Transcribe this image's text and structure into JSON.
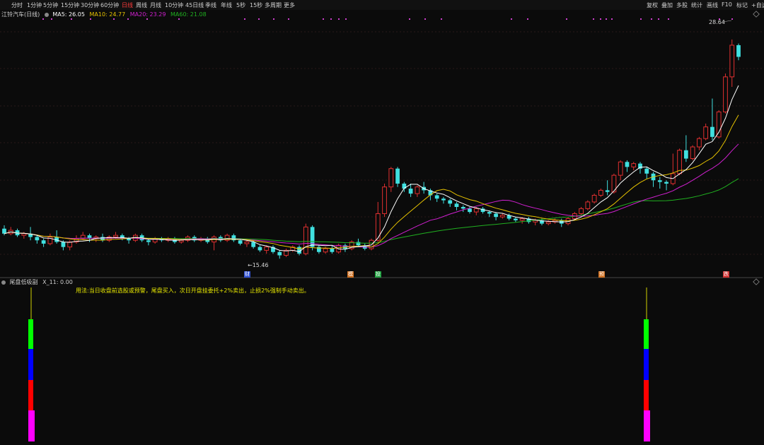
{
  "toolbar": {
    "tabs": [
      "分时",
      "1分钟",
      "5分钟",
      "15分钟",
      "30分钟",
      "60分钟",
      "日线",
      "周线",
      "月线",
      "10分钟",
      "45日线",
      "季线",
      "年线",
      "5秒",
      "15秒",
      "多周期",
      "更多"
    ],
    "active": "日线",
    "right": [
      "复权",
      "叠加",
      "多股",
      "统计",
      "画线",
      "F10",
      "标记",
      "+自选"
    ]
  },
  "header": {
    "stock": "江铃汽车(日线)",
    "ma5": "MA5: 26.05",
    "ma10": "MA10: 24.77",
    "ma20": "MA20: 23.29",
    "ma60": "MA60: 21.08"
  },
  "colors": {
    "ma5": "#ffffff",
    "ma10": "#e6c200",
    "ma20": "#d020d0",
    "ma60": "#20b020",
    "up": "#e03030",
    "down": "#40e0e0",
    "magenta_dots": "#d040d0"
  },
  "annotations": {
    "max_label": "28.64",
    "min_label": "15.46"
  },
  "signals": [
    {
      "text": "财",
      "color": "#3050d0"
    },
    {
      "text": "模",
      "color": "#d07020"
    },
    {
      "text": "投",
      "color": "#20a040"
    },
    {
      "text": "预",
      "color": "#d07020"
    },
    {
      "text": "跌",
      "color": "#d03030"
    }
  ],
  "lower": {
    "title": "尾盘低吸副",
    "value": "X_11: 0.00",
    "usage": "用法:当日收盘前选股或预警，尾盘买入，次日开盘挂委托+2%卖出，止损2%强制手动卖出。",
    "bar_colors": [
      "#ff00ff",
      "#ff0000",
      "#0000ff",
      "#00ff00",
      "#d0d000"
    ]
  },
  "chart_data": {
    "type": "candlestick",
    "title": "江铃汽车(日线)",
    "max_price": 28.64,
    "min_price": 15.46,
    "series": [
      {
        "name": "MA5",
        "last": 26.05
      },
      {
        "name": "MA10",
        "last": 24.77
      },
      {
        "name": "MA20",
        "last": 23.29
      },
      {
        "name": "MA60",
        "last": 21.08
      }
    ],
    "candles": [
      [
        17.3,
        17.0,
        17.5,
        16.9
      ],
      [
        17.0,
        17.2,
        17.4,
        16.9
      ],
      [
        17.2,
        16.9,
        17.3,
        16.8
      ],
      [
        16.9,
        17.0,
        17.1,
        16.7
      ],
      [
        17.0,
        16.8,
        17.4,
        16.6
      ],
      [
        16.8,
        16.6,
        16.9,
        16.4
      ],
      [
        16.6,
        16.4,
        16.7,
        16.2
      ],
      [
        16.4,
        16.8,
        17.0,
        16.3
      ],
      [
        16.8,
        16.5,
        17.2,
        16.4
      ],
      [
        16.5,
        16.2,
        16.6,
        16.0
      ],
      [
        16.2,
        16.5,
        16.6,
        16.0
      ],
      [
        16.5,
        16.7,
        16.9,
        16.4
      ],
      [
        16.7,
        16.9,
        17.1,
        16.6
      ],
      [
        16.9,
        16.7,
        17.0,
        16.5
      ],
      [
        16.7,
        16.8,
        16.9,
        16.5
      ],
      [
        16.8,
        16.6,
        17.0,
        16.5
      ],
      [
        16.6,
        16.8,
        16.9,
        16.5
      ],
      [
        16.8,
        16.9,
        17.1,
        16.7
      ],
      [
        16.9,
        16.7,
        17.0,
        16.6
      ],
      [
        16.7,
        16.6,
        16.8,
        16.4
      ],
      [
        16.6,
        16.9,
        17.0,
        16.5
      ],
      [
        16.9,
        16.6,
        17.0,
        16.5
      ],
      [
        16.6,
        16.5,
        16.7,
        16.3
      ],
      [
        16.5,
        16.7,
        16.8,
        16.4
      ],
      [
        16.7,
        16.6,
        16.8,
        16.5
      ],
      [
        16.6,
        16.7,
        16.8,
        16.5
      ],
      [
        16.7,
        16.5,
        16.8,
        16.4
      ],
      [
        16.5,
        16.6,
        16.7,
        16.4
      ],
      [
        16.6,
        16.8,
        16.9,
        16.5
      ],
      [
        16.8,
        16.6,
        16.9,
        16.5
      ],
      [
        16.6,
        16.7,
        16.8,
        16.5
      ],
      [
        16.7,
        16.5,
        16.8,
        16.4
      ],
      [
        16.5,
        16.8,
        16.9,
        16.0
      ],
      [
        16.8,
        16.6,
        16.9,
        16.5
      ],
      [
        16.6,
        16.9,
        17.0,
        16.5
      ],
      [
        16.9,
        16.6,
        17.0,
        16.5
      ],
      [
        16.6,
        16.4,
        16.7,
        16.3
      ],
      [
        16.4,
        16.5,
        16.6,
        16.2
      ],
      [
        16.5,
        16.2,
        16.6,
        16.1
      ],
      [
        16.2,
        16.0,
        16.3,
        15.9
      ],
      [
        16.0,
        16.2,
        16.3,
        15.8
      ],
      [
        16.2,
        15.9,
        16.3,
        15.8
      ],
      [
        15.9,
        15.7,
        16.0,
        15.5
      ],
      [
        15.7,
        16.0,
        16.1,
        15.6
      ],
      [
        16.0,
        16.2,
        16.3,
        15.9
      ],
      [
        16.2,
        15.8,
        16.3,
        15.7
      ],
      [
        15.8,
        17.4,
        17.6,
        15.7
      ],
      [
        17.4,
        16.2,
        17.5,
        16.0
      ],
      [
        16.2,
        15.9,
        16.3,
        15.8
      ],
      [
        15.9,
        16.1,
        16.2,
        15.8
      ],
      [
        16.1,
        15.9,
        16.3,
        15.8
      ],
      [
        15.9,
        16.3,
        16.4,
        15.8
      ],
      [
        16.3,
        16.1,
        16.4,
        15.9
      ],
      [
        16.1,
        16.5,
        16.6,
        16.0
      ],
      [
        16.5,
        16.3,
        16.7,
        16.2
      ],
      [
        16.3,
        16.1,
        16.4,
        16.0
      ],
      [
        16.1,
        16.6,
        16.7,
        16.0
      ],
      [
        16.6,
        18.2,
        18.9,
        16.5
      ],
      [
        18.2,
        19.8,
        20.0,
        18.0
      ],
      [
        19.8,
        20.9,
        21.0,
        19.5
      ],
      [
        20.9,
        20.0,
        21.0,
        19.8
      ],
      [
        20.0,
        19.7,
        20.1,
        19.5
      ],
      [
        19.7,
        19.4,
        20.0,
        19.2
      ],
      [
        19.4,
        19.8,
        19.9,
        19.2
      ],
      [
        19.8,
        19.6,
        20.1,
        19.4
      ],
      [
        19.6,
        19.3,
        19.7,
        19.0
      ],
      [
        19.3,
        19.1,
        19.4,
        18.9
      ],
      [
        19.1,
        19.0,
        19.2,
        18.8
      ],
      [
        19.0,
        18.8,
        19.1,
        18.6
      ],
      [
        18.8,
        18.6,
        18.9,
        18.4
      ],
      [
        18.6,
        18.5,
        18.7,
        18.3
      ],
      [
        18.5,
        18.3,
        18.6,
        18.2
      ],
      [
        18.3,
        18.5,
        18.6,
        18.1
      ],
      [
        18.5,
        18.3,
        18.6,
        18.2
      ],
      [
        18.3,
        18.2,
        18.4,
        18.0
      ],
      [
        18.2,
        18.0,
        18.3,
        17.8
      ],
      [
        18.0,
        18.1,
        18.2,
        17.9
      ],
      [
        18.1,
        17.9,
        18.2,
        17.8
      ],
      [
        17.9,
        17.8,
        18.0,
        17.7
      ],
      [
        17.8,
        17.9,
        18.0,
        17.6
      ],
      [
        17.9,
        17.7,
        18.0,
        17.6
      ],
      [
        17.7,
        17.8,
        17.9,
        17.5
      ],
      [
        17.8,
        17.6,
        17.9,
        17.5
      ],
      [
        17.6,
        17.7,
        17.8,
        17.5
      ],
      [
        17.7,
        17.8,
        17.9,
        17.6
      ],
      [
        17.8,
        17.6,
        17.9,
        17.4
      ],
      [
        17.6,
        17.9,
        18.0,
        17.5
      ],
      [
        17.9,
        18.2,
        18.3,
        17.8
      ],
      [
        18.2,
        18.5,
        18.6,
        18.1
      ],
      [
        18.5,
        18.9,
        19.0,
        18.4
      ],
      [
        18.9,
        19.3,
        19.4,
        18.8
      ],
      [
        19.3,
        19.6,
        19.7,
        19.2
      ],
      [
        19.6,
        19.5,
        20.2,
        19.3
      ],
      [
        19.5,
        20.5,
        20.6,
        19.4
      ],
      [
        20.5,
        21.3,
        21.4,
        20.2
      ],
      [
        21.3,
        21.0,
        21.4,
        20.7
      ],
      [
        21.0,
        21.2,
        21.3,
        20.8
      ],
      [
        21.2,
        20.9,
        21.3,
        20.6
      ],
      [
        20.9,
        20.6,
        21.0,
        20.3
      ],
      [
        20.6,
        20.2,
        20.7,
        19.8
      ],
      [
        20.2,
        20.1,
        20.4,
        19.7
      ],
      [
        20.1,
        20.0,
        20.2,
        19.6
      ],
      [
        20.0,
        20.6,
        21.8,
        19.9
      ],
      [
        20.6,
        22.0,
        22.1,
        20.5
      ],
      [
        22.0,
        21.5,
        22.9,
        21.3
      ],
      [
        21.5,
        22.2,
        22.3,
        21.4
      ],
      [
        22.2,
        22.7,
        22.8,
        22.0
      ],
      [
        22.7,
        23.4,
        23.6,
        22.6
      ],
      [
        23.4,
        22.8,
        25.1,
        22.6
      ],
      [
        22.8,
        24.3,
        24.4,
        22.7
      ],
      [
        24.3,
        26.4,
        26.6,
        24.2
      ],
      [
        26.4,
        28.3,
        28.64,
        25.8
      ],
      [
        28.3,
        27.6,
        28.4,
        27.4
      ]
    ]
  }
}
